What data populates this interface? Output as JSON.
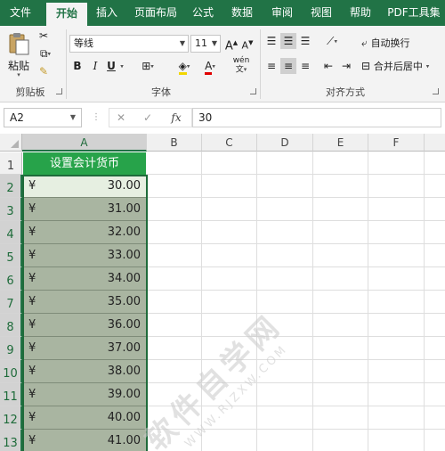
{
  "tabs": [
    "文件",
    "开始",
    "插入",
    "页面布局",
    "公式",
    "数据",
    "审阅",
    "视图",
    "帮助",
    "PDF工具集"
  ],
  "active_tab": "开始",
  "ribbon": {
    "clipboard": {
      "paste_label": "粘贴",
      "group_label": "剪贴板"
    },
    "font": {
      "font_name": "等线",
      "font_size": "11",
      "grow": "A",
      "shrink": "A",
      "bold": "B",
      "italic": "I",
      "underline": "U",
      "font_color": "A",
      "phonetic": "wén",
      "group_label": "字体"
    },
    "alignment": {
      "wrap_text": "自动换行",
      "merge_center": "合并后居中",
      "group_label": "对齐方式"
    }
  },
  "formula_bar": {
    "name_box": "A2",
    "cancel": "✕",
    "enter": "✓",
    "fx": "fx",
    "value": "30"
  },
  "columns": [
    "A",
    "B",
    "C",
    "D",
    "E",
    "F"
  ],
  "rows": [
    "1",
    "2",
    "3",
    "4",
    "5",
    "6",
    "7",
    "8",
    "9",
    "10",
    "11",
    "12",
    "13"
  ],
  "header_cell": "设置会计货币",
  "currency_symbol": "¥",
  "values": [
    "30.00",
    "31.00",
    "32.00",
    "33.00",
    "34.00",
    "35.00",
    "36.00",
    "37.00",
    "38.00",
    "39.00",
    "40.00",
    "41.00"
  ],
  "watermark": {
    "main": "软件自学网",
    "sub": "WWW.RJZXW.COM"
  },
  "colors": {
    "excel_green": "#217346",
    "header_fill": "#27a34a",
    "data_fill": "#a9b5a1"
  }
}
